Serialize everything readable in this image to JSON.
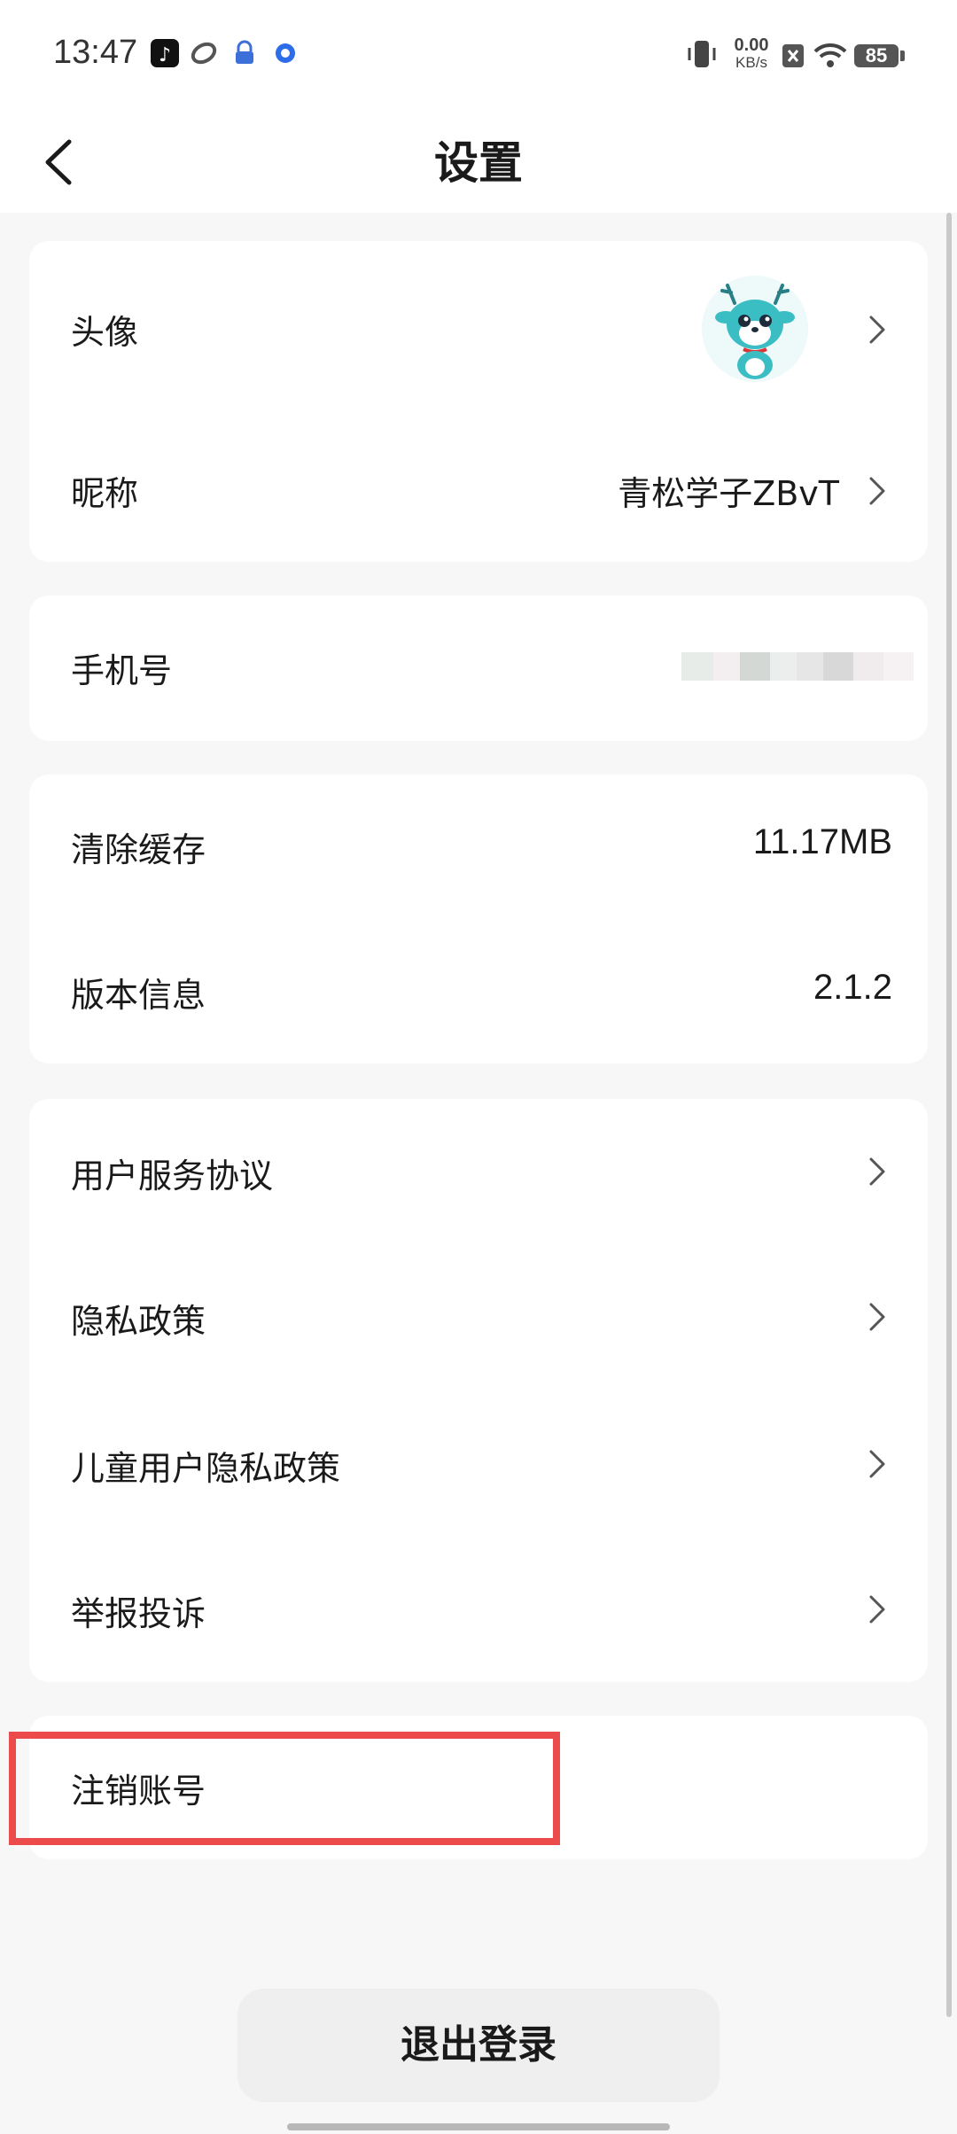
{
  "status_bar": {
    "time": "13:47",
    "net_speed_value": "0.00",
    "net_speed_unit": "KB/s",
    "battery": "85",
    "icons": [
      "tiktok-icon",
      "swirl-app-icon",
      "lock-app-icon",
      "circle-app-icon",
      "vibrate-icon",
      "sim-off-icon",
      "wifi-icon",
      "battery-icon"
    ]
  },
  "header": {
    "title": "设置"
  },
  "profile": {
    "avatar_label": "头像",
    "nickname_label": "昵称",
    "nickname_value": "青松学子ZBvT"
  },
  "account": {
    "phone_label": "手机号"
  },
  "storage": {
    "clear_cache_label": "清除缓存",
    "cache_size": "11.17MB",
    "version_label": "版本信息",
    "version_value": "2.1.2"
  },
  "legal": {
    "items": [
      {
        "label": "用户服务协议"
      },
      {
        "label": "隐私政策"
      },
      {
        "label": "儿童用户隐私政策"
      },
      {
        "label": "举报投诉"
      }
    ]
  },
  "danger": {
    "delete_account_label": "注销账号"
  },
  "footer": {
    "logout_label": "退出登录"
  },
  "colors": {
    "highlight": "#ec4b4b",
    "avatar_main": "#3bbdc4",
    "background": "#f7f7f7"
  }
}
